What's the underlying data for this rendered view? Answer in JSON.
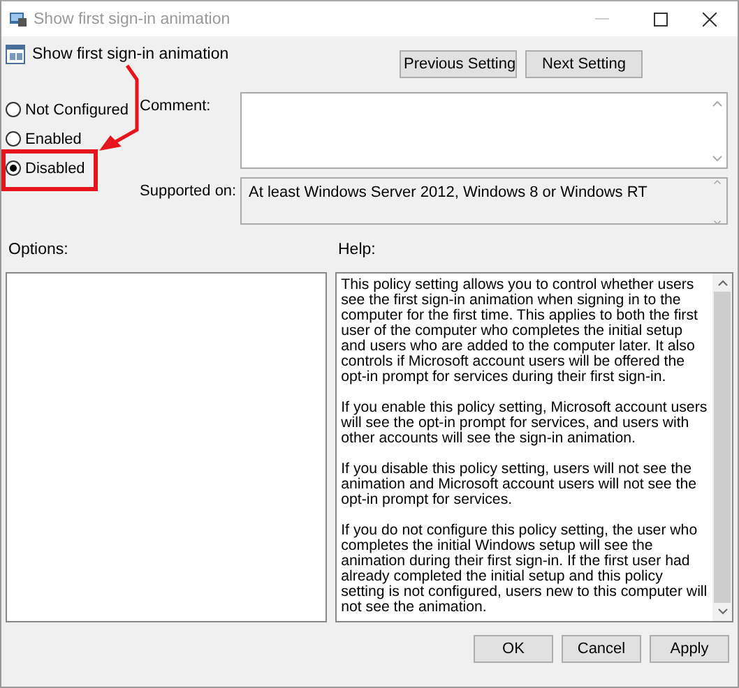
{
  "window": {
    "title": "Show first sign-in animation"
  },
  "setting": {
    "name": "Show first sign-in animation"
  },
  "nav_buttons": [
    "Previous Setting",
    "Next Setting"
  ],
  "states": [
    {
      "label": "Not Configured",
      "selected": false
    },
    {
      "label": "Enabled",
      "selected": false
    },
    {
      "label": "Disabled",
      "selected": true
    }
  ],
  "comment": {
    "label": "Comment:"
  },
  "supported_on": {
    "label": "Supported on:",
    "value": "At least Windows Server 2012, Windows 8 or Windows RT"
  },
  "options": {
    "label": "Options:"
  },
  "help": {
    "label": "Help:",
    "paragraphs": [
      "This policy setting allows you to control whether users see the first sign-in animation when signing in to the computer for the first time.  This applies to both the first user of the computer who completes the initial setup and users who are added to the computer later.  It also controls if Microsoft account users will be offered the opt-in prompt for services during their first sign-in.",
      "If you enable this policy setting, Microsoft account users will see the opt-in prompt for services, and users with other accounts will see the sign-in animation.",
      "If you disable this policy setting, users will not see the animation and Microsoft account users will not see the opt-in prompt for services.",
      "If you do not configure this policy setting, the user who completes the initial Windows setup will see the animation during their first sign-in. If the first user had already completed the initial setup and this policy setting is not configured, users new to this computer will not see the animation."
    ]
  },
  "buttons": [
    "OK",
    "Cancel",
    "Apply"
  ],
  "annotations": {
    "arrow": true,
    "frame": true
  }
}
